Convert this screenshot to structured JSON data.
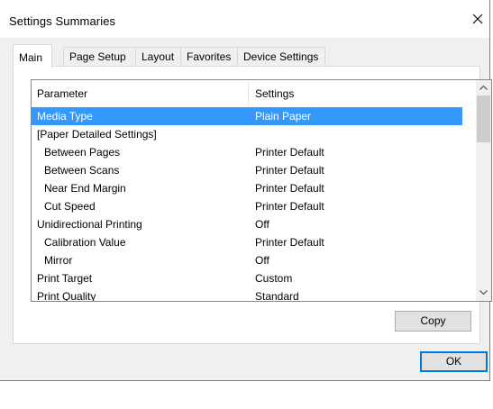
{
  "window": {
    "title": "Settings Summaries",
    "close_label": "×"
  },
  "tabs": [
    {
      "label": "Main",
      "active": true
    },
    {
      "label": "Page Setup",
      "active": false
    },
    {
      "label": "Layout",
      "active": false
    },
    {
      "label": "Favorites",
      "active": false
    },
    {
      "label": "Device Settings",
      "active": false
    }
  ],
  "list": {
    "columns": {
      "parameter": "Parameter",
      "settings": "Settings"
    },
    "rows": [
      {
        "parameter": "Media Type",
        "setting": "Plain Paper",
        "selected": true,
        "indent": false
      },
      {
        "parameter": "[Paper Detailed Settings]",
        "setting": "",
        "selected": false,
        "indent": false
      },
      {
        "parameter": "Between Pages",
        "setting": "Printer Default",
        "selected": false,
        "indent": true
      },
      {
        "parameter": "Between Scans",
        "setting": "Printer Default",
        "selected": false,
        "indent": true
      },
      {
        "parameter": "Near End Margin",
        "setting": "Printer Default",
        "selected": false,
        "indent": true
      },
      {
        "parameter": "Cut Speed",
        "setting": "Printer Default",
        "selected": false,
        "indent": true
      },
      {
        "parameter": "Unidirectional Printing",
        "setting": "Off",
        "selected": false,
        "indent": false
      },
      {
        "parameter": "Calibration Value",
        "setting": "Printer Default",
        "selected": false,
        "indent": true
      },
      {
        "parameter": "Mirror",
        "setting": "Off",
        "selected": false,
        "indent": true
      },
      {
        "parameter": "Print Target",
        "setting": "Custom",
        "selected": false,
        "indent": false
      },
      {
        "parameter": "Print Quality",
        "setting": "Standard",
        "selected": false,
        "indent": false
      }
    ]
  },
  "buttons": {
    "copy": "Copy",
    "ok": "OK"
  },
  "colors": {
    "selection": "#3399ff",
    "dialog_bg": "#f0f0f0",
    "default_button_border": "#0078d7"
  },
  "icons": {
    "close": "close-icon",
    "scroll_up": "chevron-up-icon",
    "scroll_down": "chevron-down-icon"
  }
}
